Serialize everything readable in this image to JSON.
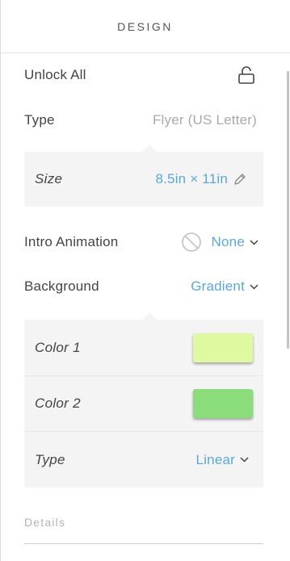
{
  "header": {
    "title": "DESIGN"
  },
  "unlock": {
    "label": "Unlock All",
    "icon": "unlock-icon"
  },
  "type_row": {
    "label": "Type",
    "value": "Flyer (US Letter)"
  },
  "size": {
    "label": "Size",
    "value": "8.5in × 11in",
    "icon": "pencil-icon"
  },
  "intro_animation": {
    "label": "Intro Animation",
    "value": "None",
    "icon": "no-symbol-icon"
  },
  "background": {
    "label": "Background",
    "value": "Gradient"
  },
  "gradient": {
    "color1": {
      "label": "Color 1",
      "swatch": "#def9a0"
    },
    "color2": {
      "label": "Color 2",
      "swatch": "#8bdc7a"
    },
    "type": {
      "label": "Type",
      "value": "Linear"
    }
  },
  "details": {
    "label": "Details"
  },
  "colors": {
    "accent": "#5aa8d6",
    "muted": "#a9a9a9",
    "panel": "#f4f4f4"
  }
}
